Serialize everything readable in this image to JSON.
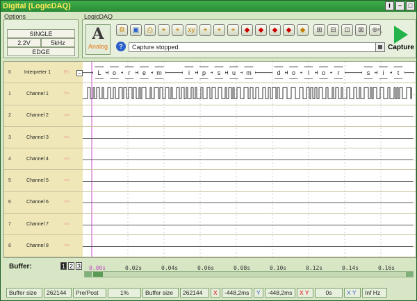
{
  "window": {
    "title": "Digital (LogicDAQ)"
  },
  "options": {
    "label": "Options",
    "mode": "SINGLE",
    "voltage": "2.2V",
    "rate": "5kHz",
    "trigger": "EDGE"
  },
  "logicdaq": {
    "label": "LogicDAQ",
    "analog_label": "Analog",
    "status_text": "Capture stopped.",
    "capture_label": "Capture"
  },
  "channels": [
    {
      "num": "II",
      "name": "Interpreter 1",
      "mark": "E×"
    },
    {
      "num": "1",
      "name": "Channel 1",
      "mark": "†×"
    },
    {
      "num": "2",
      "name": "Channel 2",
      "mark": "××"
    },
    {
      "num": "3",
      "name": "Channel 3",
      "mark": "××"
    },
    {
      "num": "4",
      "name": "Channel 4",
      "mark": "××"
    },
    {
      "num": "5",
      "name": "Channel 5",
      "mark": "××"
    },
    {
      "num": "6",
      "name": "Channel 6",
      "mark": "××"
    },
    {
      "num": "7",
      "name": "Channel 7",
      "mark": "××"
    },
    {
      "num": "8",
      "name": "Channel 8",
      "mark": "××"
    }
  ],
  "decoded": [
    "L",
    "o",
    "r",
    "e",
    "m",
    "i",
    "p",
    "s",
    "u",
    "m",
    "d",
    "o",
    "l",
    "o",
    "r",
    "s",
    "i",
    "t"
  ],
  "buffer": {
    "label": "Buffer:",
    "pages": [
      "1",
      "2",
      "3"
    ],
    "ticks": [
      "0.00s",
      "0.02s",
      "0.04s",
      "0.06s",
      "0.08s",
      "0.10s",
      "0.12s",
      "0.14s",
      "0.16s"
    ]
  },
  "statusbar": {
    "buffer_size_label": "Buffer size",
    "buffer_size_value": "262144",
    "prepost_label": "Pre/Post",
    "prepost_value": "1%",
    "buffer_size2_label": "Buffer size",
    "buffer_size2_value": "262144",
    "x_label": "X",
    "x_value": "-448,2ms",
    "y_label": "Y",
    "y_value": "-448,2ms",
    "xy_label": "X Y",
    "xy_value": "0s",
    "xy2_label": "X Y",
    "freq_value": "Inf Hz"
  }
}
